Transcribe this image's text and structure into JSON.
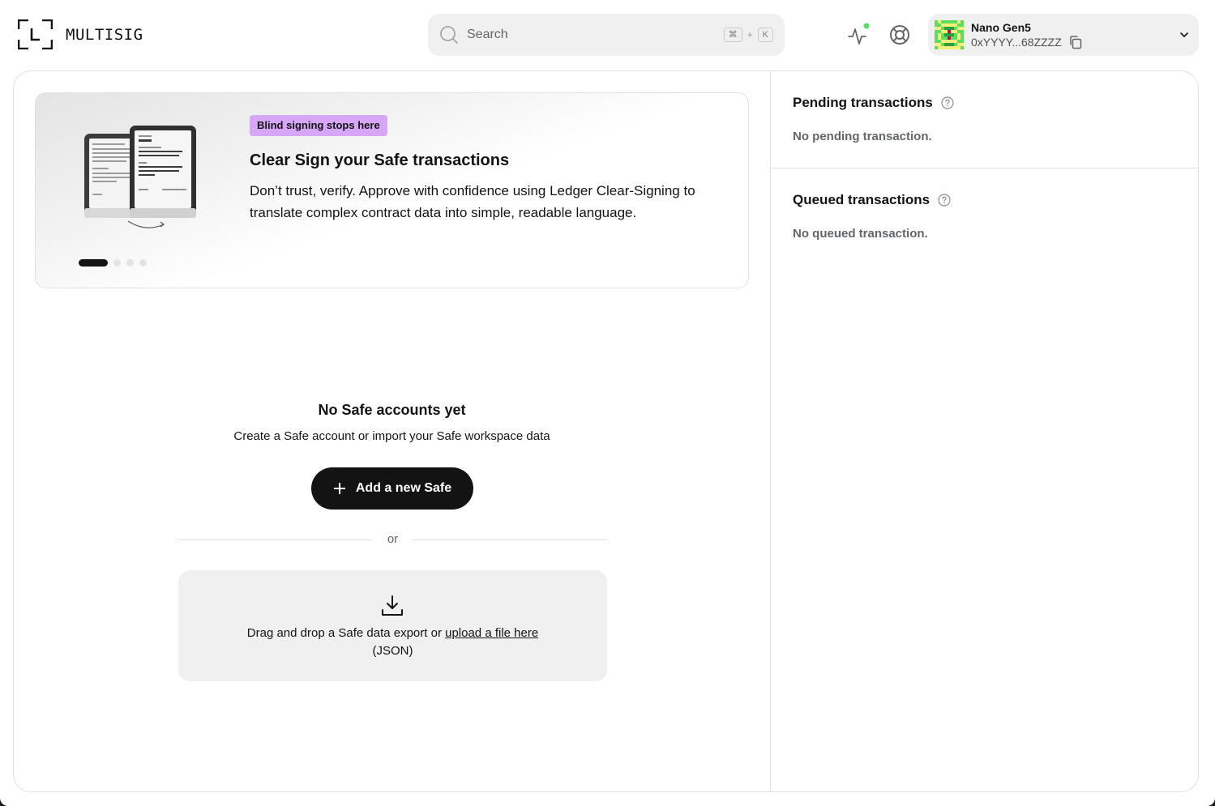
{
  "app": {
    "logo_text": "MULTISIG"
  },
  "search": {
    "placeholder": "Search",
    "shortcut_mod": "⌘",
    "shortcut_plus": "+",
    "shortcut_key": "K"
  },
  "wallet": {
    "name": "Nano Gen5",
    "address": "0xYYYY...68ZZZZ"
  },
  "banner": {
    "badge": "Blind signing stops here",
    "title": "Clear Sign your Safe transactions",
    "text": "Don’t trust, verify. Approve with confidence using Ledger Clear-Signing to translate complex contract data into simple, readable language.",
    "slide_count": 4,
    "active_slide": 1
  },
  "empty_state": {
    "title": "No Safe accounts yet",
    "subtitle": "Create a Safe account or import your Safe workspace data",
    "add_button": "Add a new Safe",
    "or": "or",
    "drop_text_prefix": "Drag and drop a Safe data export or ",
    "drop_link": "upload a file here",
    "drop_suffix": "(JSON)"
  },
  "pending": {
    "title": "Pending transactions",
    "empty": "No pending transaction."
  },
  "queued": {
    "title": "Queued transactions",
    "empty": "No queued transaction."
  },
  "colors": {
    "accent_green": "#5fdd5e",
    "badge_purple": "#d7a6f6",
    "primary": "#121312"
  },
  "icons": {
    "search": "search-icon",
    "activity": "activity-icon",
    "help": "lifebuoy-icon",
    "copy": "copy-icon",
    "chevron": "chevron-down-icon",
    "plus": "plus-icon",
    "download": "download-icon",
    "info": "question-circle-icon"
  }
}
